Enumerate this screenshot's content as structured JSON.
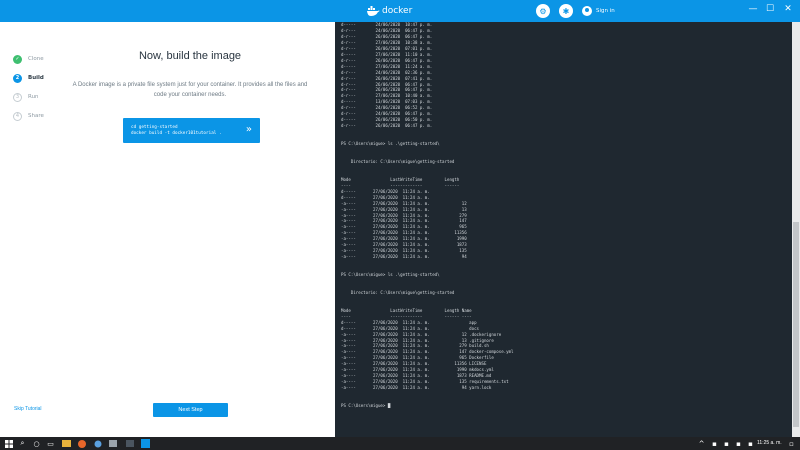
{
  "titlebar": {
    "brand": "docker",
    "signin_label": "Sign in",
    "minimize": "—",
    "maximize": "☐",
    "close": "✕"
  },
  "tutorial": {
    "steps": [
      {
        "num": "✓",
        "label": "Clone",
        "state": "done"
      },
      {
        "num": "2",
        "label": "Build",
        "state": "active"
      },
      {
        "num": "3",
        "label": "Run",
        "state": "todo"
      },
      {
        "num": "4",
        "label": "Share",
        "state": "todo"
      }
    ],
    "heading": "Now, build the image",
    "description": "A Docker image is a private file system just for your container. It provides all the files and code your container needs.",
    "command_line1": "cd getting-started",
    "command_line2": "docker build -t docker101tutorial .",
    "skip_label": "Skip Tutorial",
    "next_label": "Next Step"
  },
  "terminal": {
    "text": "d-----        24/06/2020  10:47 p. m.\nd-r---        24/06/2020  06:47 p. m.\nd-r---        26/06/2020  06:47 p. m.\nd-r---        27/06/2020  10:38 a. m.\nd-r---        26/06/2020  07:01 p. m.\nd-----        27/06/2020  11:10 a. m.\nd-r---        26/06/2020  06:47 p. m.\nd-----        27/06/2020  11:24 a. m.\nd-r---        24/06/2020  02:36 p. m.\nd-r---        26/06/2020  07:41 p. m.\nd-r---        26/06/2020  06:47 p. m.\nd-r---        26/06/2020  06:47 p. m.\nd-r---        27/06/2020  10:40 a. m.\nd-----        13/06/2020  07:03 p. m.\nd-r---        24/06/2020  06:52 p. m.\nd-r---        24/06/2020  06:47 p. m.\nd-----        26/06/2020  06:50 p. m.\nd-r---        26/06/2020  06:47 p. m.\n\n\nPS C:\\Users\\migue> ls .\\getting-started\\\n\n\n    Directorio: C:\\Users\\migue\\getting-started\n\n\nMode                LastWriteTime         Length\n----                -------------         ------\nd-----       27/06/2020  11:24 a. m.\nd-----       27/06/2020  11:24 a. m.\n-a----       27/06/2020  11:24 a. m.             12\n-a----       27/06/2020  11:24 a. m.             13\n-a----       27/06/2020  11:24 a. m.            279\n-a----       27/06/2020  11:24 a. m.            147\n-a----       27/06/2020  11:24 a. m.            965\n-a----       27/06/2020  11:24 a. m.          11356\n-a----       27/06/2020  11:24 a. m.           1990\n-a----       27/06/2020  11:24 a. m.           1873\n-a----       27/06/2020  11:24 a. m.            135\n-a----       27/06/2020  11:24 a. m.             94\n\n\nPS C:\\Users\\migue> ls .\\getting-started\\\n\n\n    Directorio: C:\\Users\\migue\\getting-started\n\n\nMode                LastWriteTime         Length Name\n----                -------------         ------ ----\nd-----       27/06/2020  11:24 a. m.                app\nd-----       27/06/2020  11:24 a. m.                docs\n-a----       27/06/2020  11:24 a. m.             12 .dockerignore\n-a----       27/06/2020  11:24 a. m.             13 .gitignore\n-a----       27/06/2020  11:24 a. m.            279 build.sh\n-a----       27/06/2020  11:24 a. m.            147 docker-compose.yml\n-a----       27/06/2020  11:24 a. m.            965 Dockerfile\n-a----       27/06/2020  11:24 a. m.          11356 LICENSE\n-a----       27/06/2020  11:24 a. m.           1990 mkdocs.yml\n-a----       27/06/2020  11:24 a. m.           1873 README.md\n-a----       27/06/2020  11:24 a. m.            135 requirements.txt\n-a----       27/06/2020  11:24 a. m.             94 yarn.lock\n\n\nPS C:\\Users\\migue> █"
  },
  "taskbar": {
    "clock": "11:25 a. m."
  }
}
